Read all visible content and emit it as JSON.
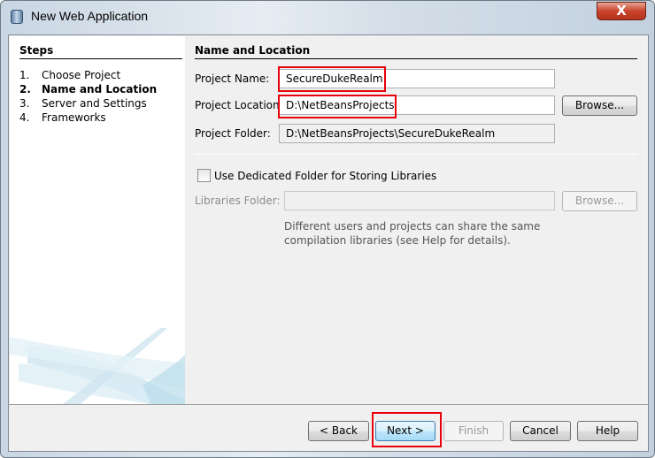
{
  "window": {
    "title": "New Web Application",
    "close_glyph": "X"
  },
  "steps": {
    "heading": "Steps",
    "items": [
      {
        "num": "1.",
        "label": "Choose Project"
      },
      {
        "num": "2.",
        "label": "Name and Location"
      },
      {
        "num": "3.",
        "label": "Server and Settings"
      },
      {
        "num": "4.",
        "label": "Frameworks"
      }
    ]
  },
  "panel": {
    "heading": "Name and Location",
    "project_name_label": "Project Name:",
    "project_name": "SecureDukeRealm",
    "project_location_label": "Project Location:",
    "project_location": "D:\\NetBeansProjects",
    "browse_label": "Browse...",
    "project_folder_label": "Project Folder:",
    "project_folder": "D:\\NetBeansProjects\\SecureDukeRealm",
    "dedicated_folder_label": "Use Dedicated Folder for Storing Libraries",
    "dedicated_folder_checked": false,
    "libraries_folder_label": "Libraries Folder:",
    "libraries_folder": "",
    "libraries_browse_label": "Browse...",
    "help_line1": "Different users and projects can share the same",
    "help_line2": "compilation libraries (see Help for details)."
  },
  "footer": {
    "back": "< Back",
    "next": "Next >",
    "finish": "Finish",
    "cancel": "Cancel",
    "help": "Help"
  }
}
